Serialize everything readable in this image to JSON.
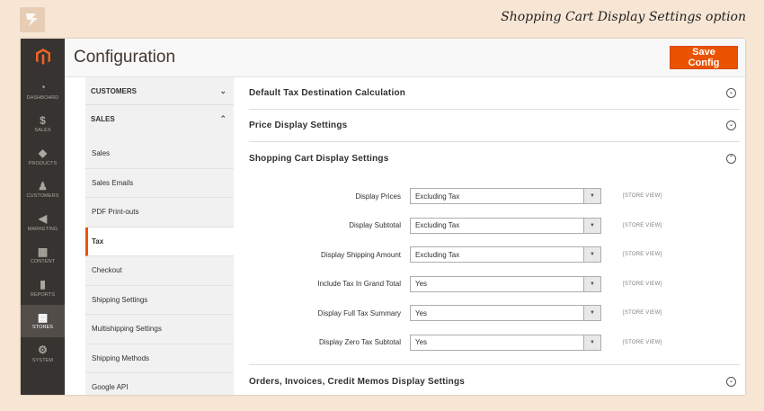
{
  "banner": {
    "title": "Shopping Cart Display Settings option"
  },
  "admin_menu": {
    "items": [
      {
        "label": "DASHBOARD",
        "icon": "dashboard-icon",
        "glyph": "◔"
      },
      {
        "label": "SALES",
        "icon": "dollar-icon",
        "glyph": "$"
      },
      {
        "label": "PRODUCTS",
        "icon": "cube-icon",
        "glyph": "◆"
      },
      {
        "label": "CUSTOMERS",
        "icon": "person-icon",
        "glyph": "♟"
      },
      {
        "label": "MARKETING",
        "icon": "megaphone-icon",
        "glyph": "◀"
      },
      {
        "label": "CONTENT",
        "icon": "layout-icon",
        "glyph": "▦"
      },
      {
        "label": "REPORTS",
        "icon": "bar-chart-icon",
        "glyph": "▮"
      },
      {
        "label": "STORES",
        "icon": "store-icon",
        "glyph": "▩"
      },
      {
        "label": "SYSTEM",
        "icon": "gear-icon",
        "glyph": "⚙"
      }
    ],
    "active": "STORES"
  },
  "header": {
    "title": "Configuration",
    "save_label": "Save Config",
    "accent": "#eb5202"
  },
  "config_nav": {
    "groups": [
      {
        "label": "CUSTOMERS",
        "state": "collapsed"
      },
      {
        "label": "SALES",
        "state": "expanded"
      }
    ],
    "items": [
      "Sales",
      "Sales Emails",
      "PDF Print-outs",
      "Tax",
      "Checkout",
      "Shipping Settings",
      "Multishipping Settings",
      "Shipping Methods",
      "Google API"
    ],
    "active_item": "Tax"
  },
  "sections": {
    "default_tax": "Default Tax Destination Calculation",
    "price_display": "Price Display Settings",
    "shopping_cart": "Shopping Cart Display Settings",
    "orders": "Orders, Invoices, Credit Memos Display Settings"
  },
  "fields": [
    {
      "label": "Display Prices",
      "value": "Excluding Tax",
      "scope": "[STORE VIEW]"
    },
    {
      "label": "Display Subtotal",
      "value": "Excluding Tax",
      "scope": "[STORE VIEW]"
    },
    {
      "label": "Display Shipping Amount",
      "value": "Excluding Tax",
      "scope": "[STORE VIEW]"
    },
    {
      "label": "Include Tax In Grand Total",
      "value": "Yes",
      "scope": "[STORE VIEW]"
    },
    {
      "label": "Display Full Tax Summary",
      "value": "Yes",
      "scope": "[STORE VIEW]"
    },
    {
      "label": "Display Zero Tax Subtotal",
      "value": "Yes",
      "scope": "[STORE VIEW]"
    }
  ]
}
